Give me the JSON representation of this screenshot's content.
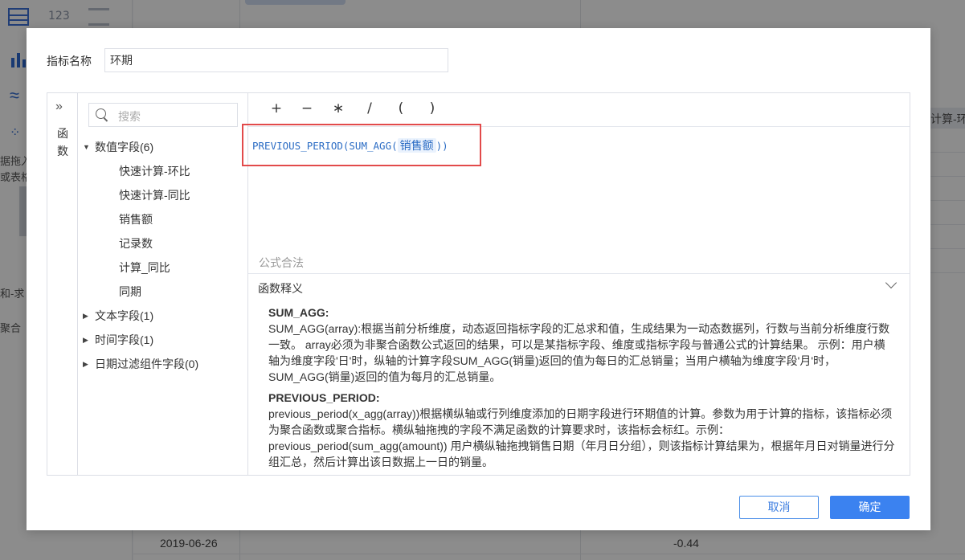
{
  "background": {
    "side_texts": [
      "据拖入",
      "或表格",
      "和-求",
      "聚合"
    ],
    "num_tool_label": "123",
    "column_header": "计算-环",
    "row_date": "2019-06-26",
    "row_value": "-0.44"
  },
  "modal": {
    "name_label": "指标名称",
    "name_value": "环期",
    "rail": {
      "expand_icon": "»",
      "label": "函数"
    },
    "search": {
      "placeholder": "搜索"
    },
    "tree": {
      "numeric_group": "数值字段(6)",
      "numeric_items": [
        "快速计算-环比",
        "快速计算-同比",
        "销售额",
        "记录数",
        "计算_同比",
        "同期"
      ],
      "text_group": "文本字段(1)",
      "time_group": "时间字段(1)",
      "date_filter_group": "日期过滤组件字段(0)"
    },
    "operators": [
      "+",
      "−",
      "∗",
      "/",
      "(",
      ")"
    ],
    "formula": {
      "prefix": "PREVIOUS_PERIOD(SUM_AGG(",
      "field": "销售额",
      "suffix": "))"
    },
    "valid_text": "公式合法",
    "explain": {
      "title": "函数释义",
      "functions": [
        {
          "name": "SUM_AGG:",
          "desc": "SUM_AGG(array):根据当前分析维度，动态返回指标字段的汇总求和值，生成结果为一动态数据列，行数与当前分析维度行数一致。 array必须为非聚合函数公式返回的结果，可以是某指标字段、维度或指标字段与普通公式的计算结果。 示例：用户横轴为维度字段'日'时，纵轴的计算字段SUM_AGG(销量)返回的值为每日的汇总销量；当用户横轴为维度字段'月'时，SUM_AGG(销量)返回的值为每月的汇总销量。"
        },
        {
          "name": "PREVIOUS_PERIOD:",
          "desc": "previous_period(x_agg(array))根据横纵轴或行列维度添加的日期字段进行环期值的计算。参数为用于计算的指标，该指标必须为聚合函数或聚合指标。横纵轴拖拽的字段不满足函数的计算要求时，该指标会标红。示例：previous_period(sum_agg(amount)) 用户横纵轴拖拽销售日期（年月日分组），则该指标计算结果为，根据年月日对销量进行分组汇总，然后计算出该日数据上一日的销量。"
        }
      ]
    },
    "buttons": {
      "cancel": "取消",
      "ok": "确定"
    },
    "colors": {
      "accent": "#3b82f0",
      "highlight": "#e24a4a",
      "formula_text": "#2b6cc4"
    }
  }
}
